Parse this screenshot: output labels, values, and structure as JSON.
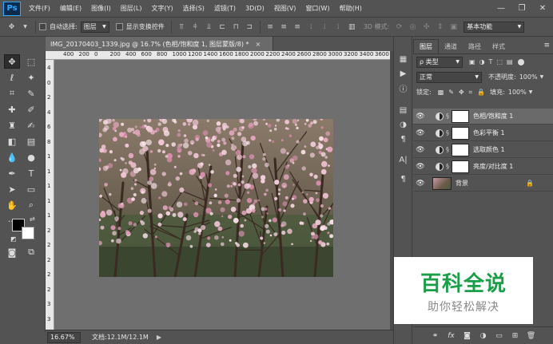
{
  "menubar": {
    "logo": "Ps",
    "items": [
      "文件(F)",
      "编辑(E)",
      "图像(I)",
      "图层(L)",
      "文字(Y)",
      "选择(S)",
      "滤镜(T)",
      "3D(D)",
      "视图(V)",
      "窗口(W)",
      "帮助(H)"
    ],
    "window_controls": [
      "—",
      "❐",
      "✕"
    ]
  },
  "options": {
    "auto_select_label": "自动选择:",
    "auto_select_value": "图层",
    "show_transform_label": "显示变换控件",
    "mode_3d_label": "3D 模式:",
    "workspace": "基本功能"
  },
  "document": {
    "tab_title": "IMG_20170403_1339.jpg @ 16.7% (色相/饱和度 1, 图层蒙版/8) *",
    "tab_close": "×",
    "ruler_top_numbers": [
      "400",
      "200",
      "0",
      "200",
      "400",
      "600",
      "800",
      "1000",
      "1200",
      "1400",
      "1600",
      "1800",
      "2000",
      "2200",
      "2400",
      "2600",
      "2800",
      "3000",
      "3200",
      "3400",
      "3600",
      "38"
    ],
    "ruler_left_numbers": [
      "4",
      "0",
      "2",
      "4",
      "6",
      "8",
      "1",
      "1",
      "1",
      "1",
      "1",
      "2",
      "2",
      "2",
      "2",
      "2",
      "3",
      "3"
    ],
    "zoom": "16.67%",
    "doc_info": "文档:12.1M/12.1M",
    "status_arrow": "▶"
  },
  "layers_panel": {
    "tabs": [
      "图层",
      "通道",
      "路径",
      "样式"
    ],
    "menu_icon": "≡",
    "filter_label": "ρ 类型",
    "blend_mode": "正常",
    "opacity_label": "不透明度:",
    "opacity_value": "100%",
    "lock_label": "锁定:",
    "fill_label": "填充:",
    "fill_value": "100%",
    "layers": [
      {
        "name": "色相/饱和度 1",
        "kind": "adjustment",
        "selected": true
      },
      {
        "name": "色彩平衡 1",
        "kind": "adjustment",
        "selected": false
      },
      {
        "name": "选取颜色 1",
        "kind": "adjustment",
        "selected": false
      },
      {
        "name": "亮度/对比度 1",
        "kind": "adjustment",
        "selected": false
      },
      {
        "name": "背景",
        "kind": "background",
        "selected": false
      }
    ],
    "bottom_icons": [
      "link-icon",
      "fx-icon",
      "mask-icon",
      "adjustment-icon",
      "folder-icon",
      "new-layer-icon",
      "trash-icon"
    ]
  },
  "watermark": {
    "title": "百科全说",
    "subtitle": "助你轻松解决",
    "title_color": "#1b9e48"
  },
  "colors": {
    "foreground": "#000000",
    "background": "#ffffff",
    "panel": "#535353",
    "canvas_bg": "#6f6f6f"
  }
}
